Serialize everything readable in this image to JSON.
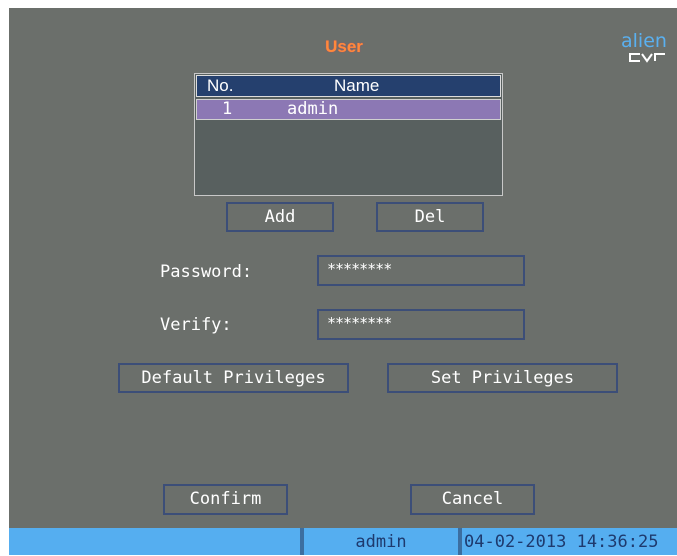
{
  "window": {
    "title": "User"
  },
  "logo": {
    "text": "alien",
    "subtext": "dvr"
  },
  "user_table": {
    "columns": [
      "No.",
      "Name"
    ],
    "rows": [
      {
        "no": "1",
        "name": "admin",
        "selected": true
      }
    ]
  },
  "buttons": {
    "add": "Add",
    "del": "Del",
    "default_privileges": "Default Privileges",
    "set_privileges": "Set Privileges",
    "confirm": "Confirm",
    "cancel": "Cancel"
  },
  "form": {
    "password_label": "Password:",
    "password_value": "********",
    "verify_label": "Verify:",
    "verify_value": "********"
  },
  "status_bar": {
    "user": "admin",
    "datetime": "04-02-2013 14:36:25"
  },
  "colors": {
    "screen_bg": "#6b6f6b",
    "title": "#ff8a3a",
    "table_header": "#25406e",
    "selected_row": "#8c78b4",
    "button_border": "#3c4e78",
    "status_bar": "#55aef0",
    "logo": "#5ab0f0"
  }
}
